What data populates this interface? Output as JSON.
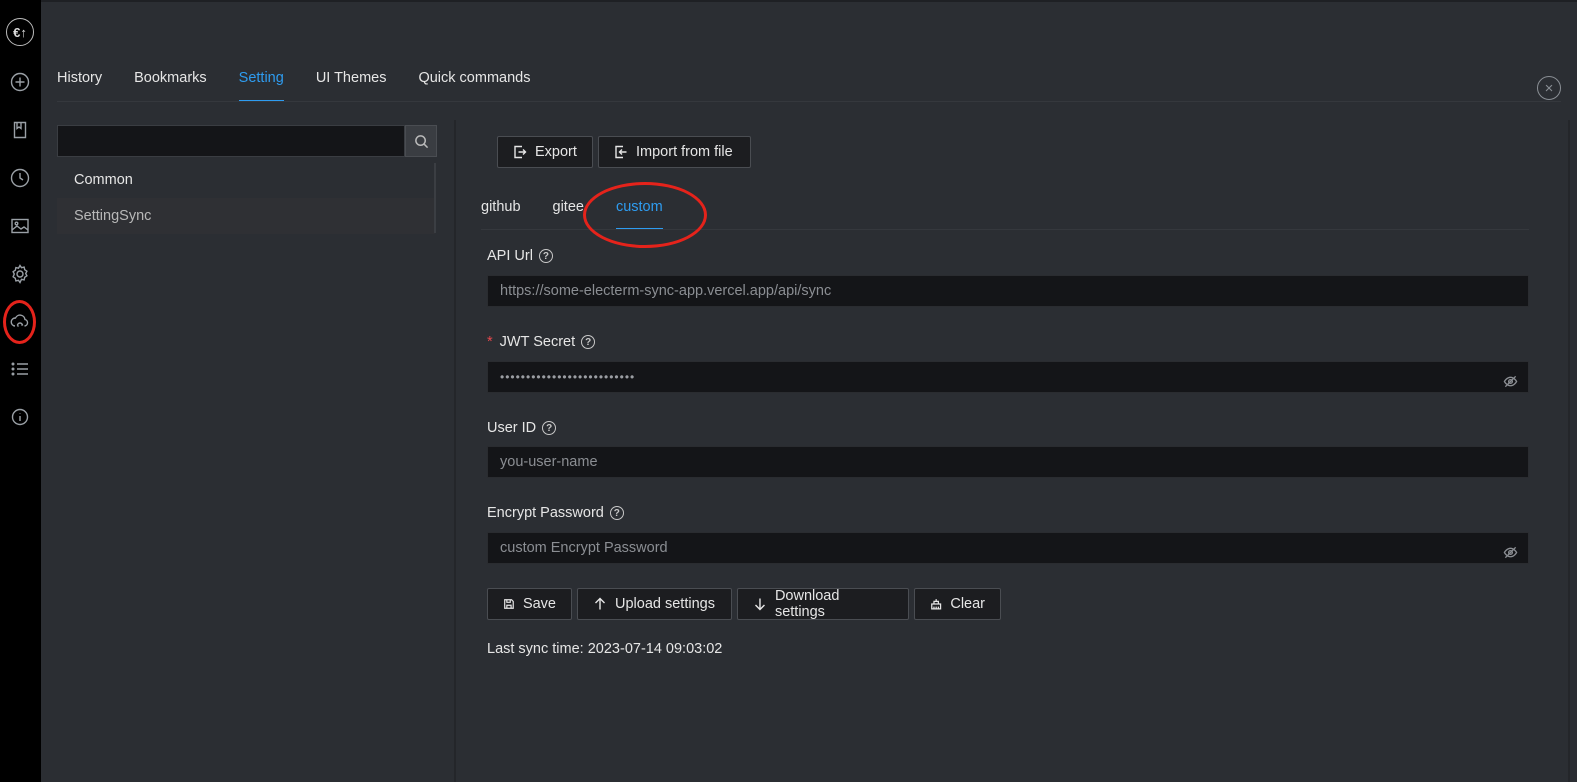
{
  "rail": {
    "logo": "€↑",
    "icons": [
      "plus-icon",
      "bookmark-icon",
      "clock-icon",
      "image-icon",
      "gear-icon",
      "cloud-sync-icon",
      "list-icon",
      "info-icon"
    ]
  },
  "tabs": [
    {
      "label": "History"
    },
    {
      "label": "Bookmarks"
    },
    {
      "label": "Setting"
    },
    {
      "label": "UI Themes"
    },
    {
      "label": "Quick commands"
    }
  ],
  "sidebar": {
    "search_placeholder": "",
    "items": [
      {
        "label": "Common"
      },
      {
        "label": "SettingSync"
      }
    ]
  },
  "toolbar": {
    "export_label": "Export",
    "import_label": "Import from file"
  },
  "sync_tabs": [
    {
      "label": "github"
    },
    {
      "label": "gitee"
    },
    {
      "label": "custom"
    }
  ],
  "form": {
    "api_url_label": "API Url",
    "api_url_placeholder": "https://some-electerm-sync-app.vercel.app/api/sync",
    "jwt_required_mark": "*",
    "jwt_label": "JWT Secret",
    "jwt_value": "••••••••••••••••••••••••••",
    "user_id_label": "User ID",
    "user_id_placeholder": "you-user-name",
    "encrypt_label": "Encrypt Password",
    "encrypt_placeholder": "custom Encrypt Password"
  },
  "actions": {
    "save": "Save",
    "upload": "Upload settings",
    "download": "Download settings",
    "clear": "Clear"
  },
  "last_sync": "Last sync time: 2023-07-14 09:03:02",
  "colors": {
    "accent": "#2e9cf0",
    "annotation": "#e5231b",
    "required": "#e5484d"
  }
}
